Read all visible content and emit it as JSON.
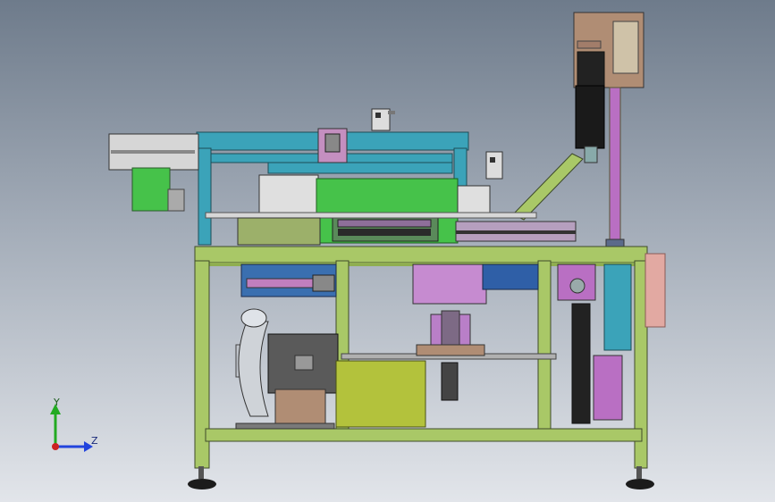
{
  "triad": {
    "y_label": "Y",
    "z_label": "Z",
    "y_color": "#22aa22",
    "z_color": "#2244dd",
    "origin_color": "#cc2222"
  },
  "colors": {
    "frame_green": "#a9c867",
    "frame_edge": "#3e4a2a",
    "top_frame_teal": "#3ba3b9",
    "bright_green": "#46c24a",
    "purple": "#b96fc3",
    "olive_box": "#b3c23c",
    "motor_grey": "#5a5a5a",
    "blower_silver": "#cfd3d8",
    "brown": "#b08d74",
    "pink": "#e2a9a2",
    "dark": "#1b1b1b"
  }
}
